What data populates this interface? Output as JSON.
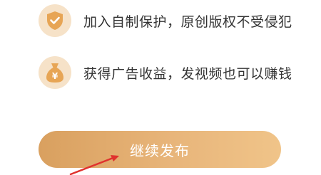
{
  "benefits": [
    {
      "icon": "shield-check-icon",
      "text": "加入自制保护，原创版权不受侵犯"
    },
    {
      "icon": "money-bag-icon",
      "icon_glyph": "¥",
      "text": "获得广告收益，发视频也可以赚钱"
    }
  ],
  "continue_button": {
    "label": "继续发布"
  },
  "colors": {
    "accent": "#e3aa6a",
    "icon_bg": "#f6e2c8",
    "icon_fg": "#e7a555",
    "annotation_arrow": "#e0322e"
  }
}
